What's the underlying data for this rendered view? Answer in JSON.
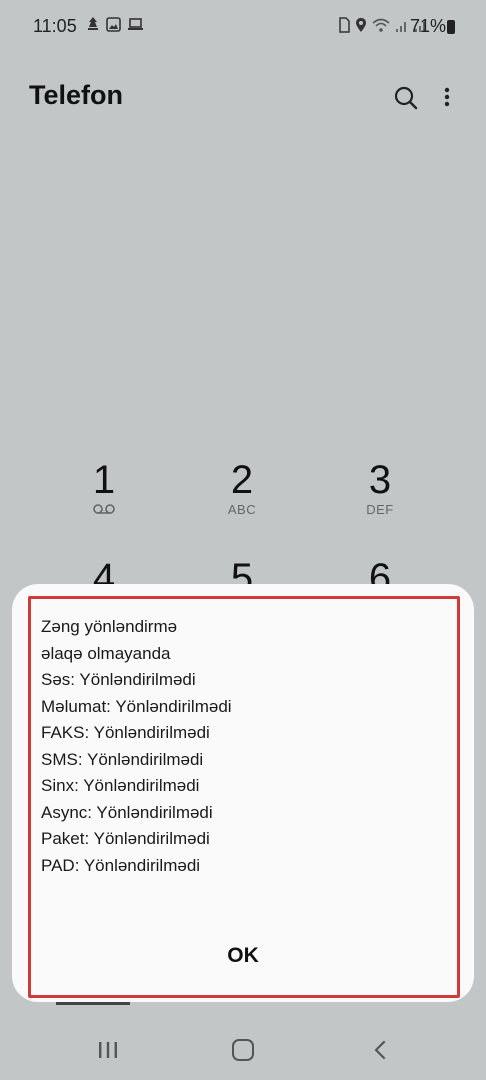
{
  "status_bar": {
    "time": "11:05",
    "battery": "71%"
  },
  "header": {
    "title": "Telefon",
    "search_icon": "search-icon",
    "more_icon": "more-vertical-icon"
  },
  "dialpad": {
    "keys": [
      {
        "digit": "1",
        "letters": ""
      },
      {
        "digit": "2",
        "letters": "ABC"
      },
      {
        "digit": "3",
        "letters": "DEF"
      },
      {
        "digit": "4",
        "letters": ""
      },
      {
        "digit": "5",
        "letters": ""
      },
      {
        "digit": "6",
        "letters": ""
      }
    ]
  },
  "dialog": {
    "lines": [
      "Zəng yönləndirmə",
      "əlaqə olmayanda",
      "Səs: Yönləndirilmədi",
      "Məlumat: Yönləndirilmədi",
      "FAKS: Yönləndirilmədi",
      "SMS: Yönləndirilmədi",
      "Sinx: Yönləndirilmədi",
      "Async: Yönləndirilmədi",
      "Paket: Yönləndirilmədi",
      "PAD: Yönləndirilmədi"
    ],
    "ok_label": "OK",
    "highlight_color": "#d03a3a"
  },
  "nav_bar": {
    "recent_icon": "recent-apps-icon",
    "home_icon": "home-icon",
    "back_icon": "back-icon"
  }
}
